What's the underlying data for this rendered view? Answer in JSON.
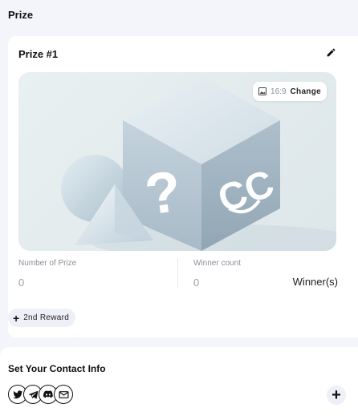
{
  "section": {
    "title": "Prize"
  },
  "prize": {
    "title": "Prize #1",
    "image": {
      "ratio": "16:9",
      "change_label": "Change"
    },
    "number_of_prize": {
      "label": "Number of Prize",
      "value": "0"
    },
    "winner_count": {
      "label": "Winner count",
      "value": "0",
      "unit": "Winner(s)"
    },
    "add_reward_label": "2nd Reward"
  },
  "contact": {
    "title": "Set Your Contact Info",
    "socials": [
      "twitter-icon",
      "telegram-icon",
      "discord-icon",
      "email-icon"
    ]
  },
  "colors": {
    "background": "#f4f5fb",
    "card": "#ffffff",
    "pill": "#eef0f8",
    "muted_text": "#8a8f98"
  }
}
